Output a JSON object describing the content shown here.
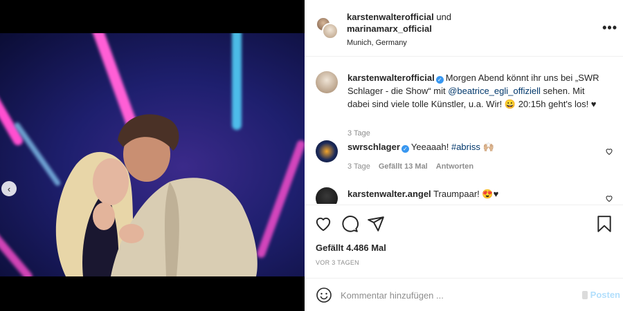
{
  "post": {
    "author": "karstenwalterofficial",
    "conjunction": "und",
    "coauthor": "marinamarx_official",
    "location": "Munich, Germany",
    "more_glyph": "•••"
  },
  "caption": {
    "author": "karstenwalterofficial",
    "text_before": "Morgen Abend könnt ihr uns bei „SWR Schlager - die Show“ mit ",
    "mention": "@beatrice_egli_offiziell",
    "text_after": " sehen. Mit dabei sind viele tolle Künstler, u.a. Wir! 😀 20:15h geht's los! ♥",
    "time": "3 Tage"
  },
  "comments": [
    {
      "author": "swrschlager",
      "verified": true,
      "text": "Yeeaaah! ",
      "tag": "#abriss",
      "trailing": " 🙌🏼",
      "time": "3 Tage",
      "likes": "Gefällt 13 Mal",
      "reply": "Antworten"
    },
    {
      "author": "karstenwalter.angel",
      "verified": false,
      "text": "Traumpaar! 😍♥",
      "tag": "",
      "trailing": ""
    }
  ],
  "actions": {
    "like_icon": "heart-icon",
    "comment_icon": "comment-bubble-icon",
    "share_icon": "paper-plane-icon",
    "save_icon": "bookmark-icon"
  },
  "likes_label": "Gefällt 4.486 Mal",
  "time_ago": "VOR 3 TAGEN",
  "comment_box": {
    "placeholder": "Kommentar hinzufügen ...",
    "post_label": "Posten"
  },
  "media": {
    "slide_count": 2,
    "active_slide": 2,
    "prev_icon": "chevron-left-icon"
  },
  "colors": {
    "link": "#00376b",
    "verified": "#3897f0",
    "post_button_disabled": "#b2dffc",
    "meta_gray": "#8e8e8e"
  }
}
